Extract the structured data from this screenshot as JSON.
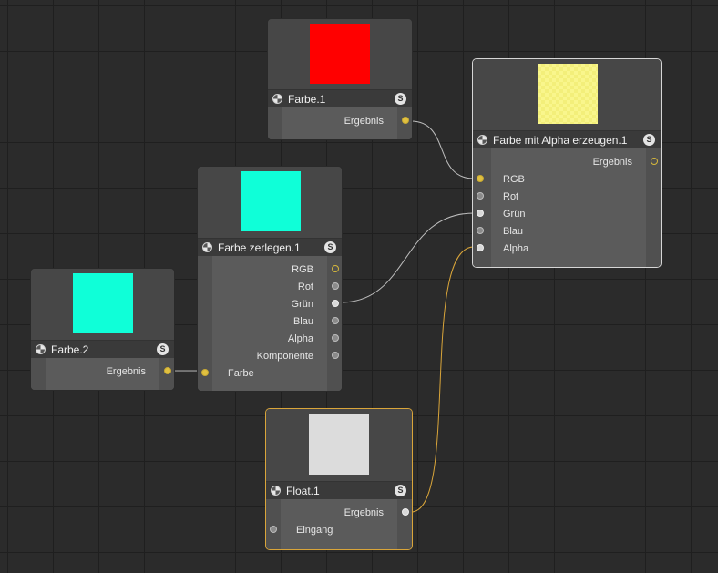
{
  "nodes": {
    "farbe1": {
      "title": "Farbe.1",
      "badge": "S",
      "preview_color": "#ff0000",
      "outputs": [
        "Ergebnis"
      ]
    },
    "farbe_mit_alpha": {
      "title": "Farbe mit Alpha erzeugen.1",
      "badge": "S",
      "preview_color": "#f9f68c",
      "outputs": [
        "Ergebnis"
      ],
      "inputs": [
        "RGB",
        "Rot",
        "Grün",
        "Blau",
        "Alpha"
      ]
    },
    "farbe_zerlegen": {
      "title": "Farbe zerlegen.1",
      "badge": "S",
      "preview_color": "#0fffd8",
      "outputs": [
        "RGB",
        "Rot",
        "Grün",
        "Blau",
        "Alpha",
        "Komponente"
      ],
      "inputs": [
        "Farbe"
      ]
    },
    "farbe2": {
      "title": "Farbe.2",
      "badge": "S",
      "preview_color": "#0fffd8",
      "outputs": [
        "Ergebnis"
      ]
    },
    "float1": {
      "title": "Float.1",
      "badge": "S",
      "preview_color": "#dcdcdc",
      "outputs": [
        "Ergebnis"
      ],
      "inputs": [
        "Eingang"
      ]
    }
  },
  "colors": {
    "canvas": "#2b2b2b",
    "wire_default": "#bdbdbd",
    "wire_selected": "#d9a53a",
    "port_color": "#e0c040",
    "port_float": "#d8d8d8"
  }
}
